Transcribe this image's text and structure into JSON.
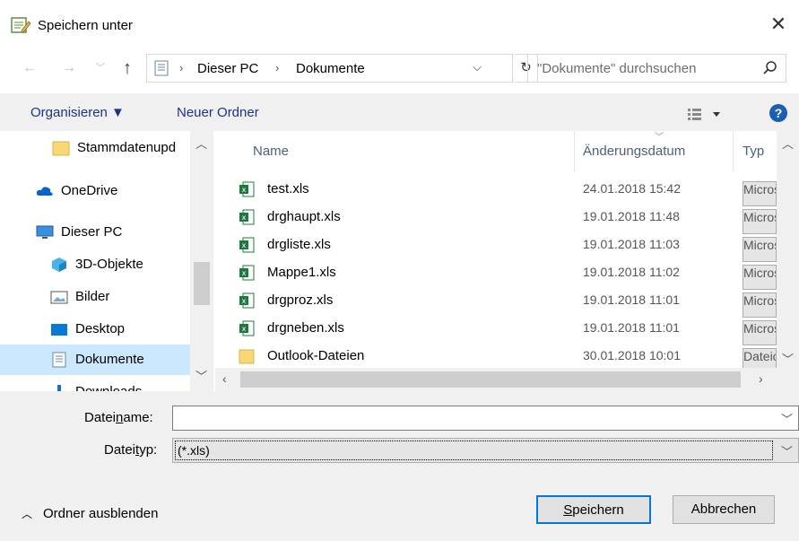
{
  "window": {
    "title": "Speichern unter"
  },
  "address": {
    "crumbs": [
      "Dieser PC",
      "Dokumente"
    ],
    "search_placeholder": "\"Dokumente\" durchsuchen"
  },
  "toolbar": {
    "organize_label": "Organisieren ▼",
    "new_folder_label": "Neuer Ordner",
    "help_label": "?"
  },
  "navpane": {
    "items": [
      {
        "label": "Stammdatenupd",
        "icon": "folder-icon"
      },
      {
        "label": "OneDrive",
        "icon": "cloud-icon"
      },
      {
        "label": "Dieser PC",
        "icon": "computer-icon"
      },
      {
        "label": "3D-Objekte",
        "icon": "cube-icon"
      },
      {
        "label": "Bilder",
        "icon": "pictures-icon"
      },
      {
        "label": "Desktop",
        "icon": "desktop-icon"
      },
      {
        "label": "Dokumente",
        "icon": "documents-icon",
        "selected": true
      },
      {
        "label": "Downloads",
        "icon": "download-icon"
      }
    ]
  },
  "filelist": {
    "columns": [
      "Name",
      "Änderungsdatum",
      "Typ"
    ],
    "rows": [
      {
        "name": "test.xls",
        "date": "24.01.2018 15:42",
        "type": "Micros",
        "icon": "excel-file-icon"
      },
      {
        "name": "drghaupt.xls",
        "date": "19.01.2018 11:48",
        "type": "Micros",
        "icon": "excel-file-icon"
      },
      {
        "name": "drgliste.xls",
        "date": "19.01.2018 11:03",
        "type": "Micros",
        "icon": "excel-file-icon"
      },
      {
        "name": "Mappe1.xls",
        "date": "19.01.2018 11:02",
        "type": "Micros",
        "icon": "excel-file-icon"
      },
      {
        "name": "drgproz.xls",
        "date": "19.01.2018 11:01",
        "type": "Micros",
        "icon": "excel-file-icon"
      },
      {
        "name": "drgneben.xls",
        "date": "19.01.2018 11:01",
        "type": "Micros",
        "icon": "excel-file-icon"
      },
      {
        "name": "Outlook-Dateien",
        "date": "30.01.2018 10:01",
        "type": "Dateio",
        "icon": "folder-icon"
      }
    ]
  },
  "form": {
    "filename_label_pre": "Datei",
    "filename_label_acc": "n",
    "filename_label_post": "ame:",
    "filename_value": "",
    "filetype_label_pre": "Datei",
    "filetype_label_acc": "t",
    "filetype_label_post": "yp:",
    "filetype_value": "(*.xls)"
  },
  "footer": {
    "hide_folders_label": "Ordner ausblenden",
    "save_acc": "S",
    "save_rest": "peichern",
    "cancel_label": "Abbrechen"
  },
  "colors": {
    "accent": "#0078d7",
    "selected_bg": "#cce8ff",
    "link": "#1e3287"
  }
}
